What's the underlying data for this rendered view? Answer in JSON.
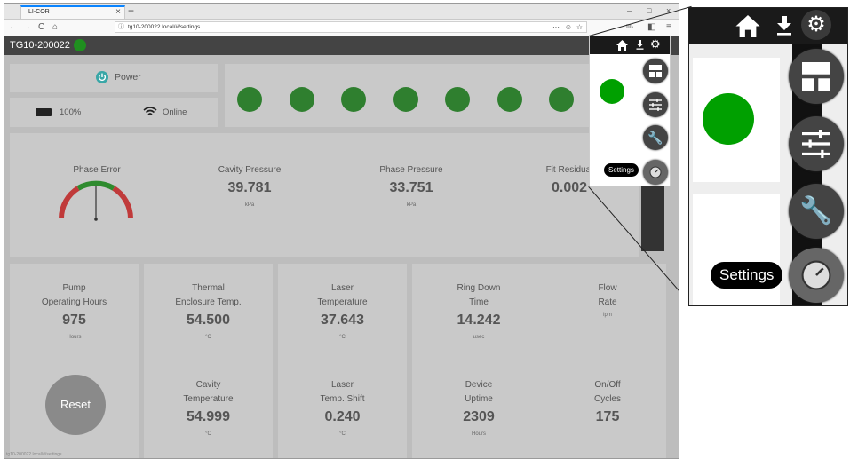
{
  "browser": {
    "tab_title": "LI-COR",
    "tab_close": "×",
    "new_tab": "+",
    "url": "tg10-200022.local/#/settings",
    "status_url": "tg10-200022.local/#/settings",
    "nav": {
      "back": "←",
      "forward": "→",
      "reload": "C",
      "home": "⌂"
    },
    "url_actions": {
      "more": "···",
      "pocket": "☺",
      "star": "☆"
    },
    "window_controls": {
      "minimize": "–",
      "maximize": "□",
      "close": "×"
    },
    "toolbar_icons": {
      "library": "III\\",
      "sidebar": "◧",
      "menu": "≡"
    }
  },
  "app": {
    "device_name": "TG10-200022",
    "status_color": "#1f8f1f",
    "power_label": "Power",
    "battery_label": "100%",
    "network_label": "Online",
    "indicator_count": 8,
    "indicator_color": "#2f7f2f",
    "highlight_indicator_color": "#00a000",
    "gauges": {
      "phase_error": {
        "label": "Phase Error"
      },
      "cavity_pressure": {
        "label": "Cavity Pressure",
        "value": "39.781",
        "unit": "kPa"
      },
      "phase_pressure": {
        "label": "Phase Pressure",
        "value": "33.751",
        "unit": "kPa"
      },
      "fit_residual": {
        "label": "Fit Residual",
        "value": "0.002"
      }
    },
    "metrics": {
      "pump_hours": {
        "line1": "Pump",
        "line2": "Operating Hours",
        "value": "975",
        "unit": "Hours"
      },
      "thermal_enclosure": {
        "line1": "Thermal",
        "line2": "Enclosure Temp.",
        "value": "54.500",
        "unit": "°C"
      },
      "laser_temp": {
        "line1": "Laser",
        "line2": "Temperature",
        "value": "37.643",
        "unit": "°C"
      },
      "ring_down": {
        "line1": "Ring Down",
        "line2": "Time",
        "value": "14.242",
        "unit": "usec"
      },
      "flow_rate": {
        "line1": "Flow",
        "line2": "Rate",
        "unit": "lpm"
      },
      "cavity_temp": {
        "line1": "Cavity",
        "line2": "Temperature",
        "value": "54.999",
        "unit": "°C"
      },
      "laser_shift": {
        "line1": "Laser",
        "line2": "Temp. Shift",
        "value": "0.240",
        "unit": "°C"
      },
      "device_uptime": {
        "line1": "Device",
        "line2": "Uptime",
        "value": "2309",
        "unit": "Hours"
      },
      "onoff_cycles": {
        "line1": "On/Off",
        "line2": "Cycles",
        "value": "175"
      }
    },
    "reset_label": "Reset",
    "side_menu": {
      "settings_tooltip": "Settings",
      "items": [
        "layout-icon",
        "sliders-icon",
        "wrench-icon",
        "gauge-icon"
      ]
    }
  },
  "zoom": {
    "settings_tooltip": "Settings"
  }
}
